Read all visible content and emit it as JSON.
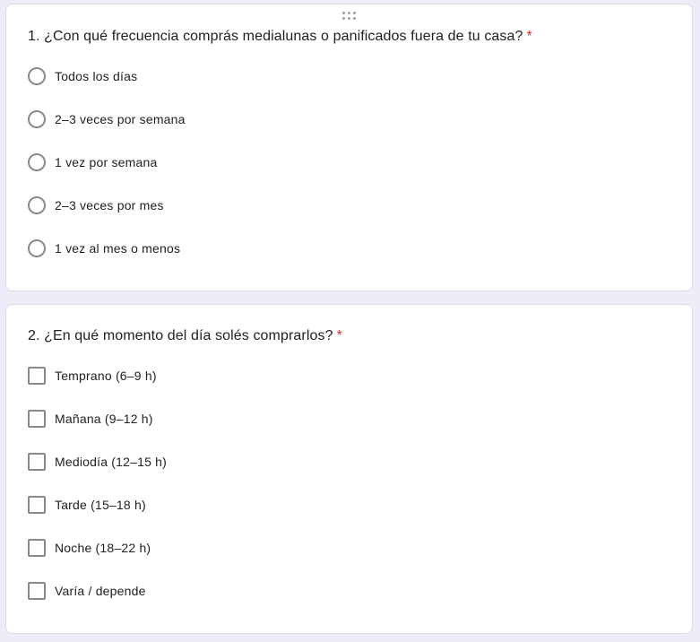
{
  "questions": [
    {
      "title": "1. ¿Con qué frecuencia comprás medialunas o panificados fuera de tu casa?",
      "required_mark": "*",
      "type": "radio",
      "options": [
        "Todos los días",
        "2–3 veces por semana",
        "1 vez por semana",
        "2–3 veces por mes",
        "1 vez al mes o menos"
      ]
    },
    {
      "title": "2. ¿En qué momento del día solés comprarlos?",
      "required_mark": "*",
      "type": "checkbox",
      "options": [
        "Temprano (6–9 h)",
        "Mañana (9–12 h)",
        "Mediodía (12–15 h)",
        "Tarde (15–18 h)",
        "Noche (18–22 h)",
        "Varía / depende"
      ]
    }
  ],
  "icons": {
    "drag_handle": "drag-handle-icon",
    "radio": "radio-button-unchecked-icon",
    "checkbox": "checkbox-unchecked-icon"
  },
  "colors": {
    "background": "#efebf9",
    "card": "#ffffff",
    "required": "#d93025",
    "text": "#202124"
  }
}
